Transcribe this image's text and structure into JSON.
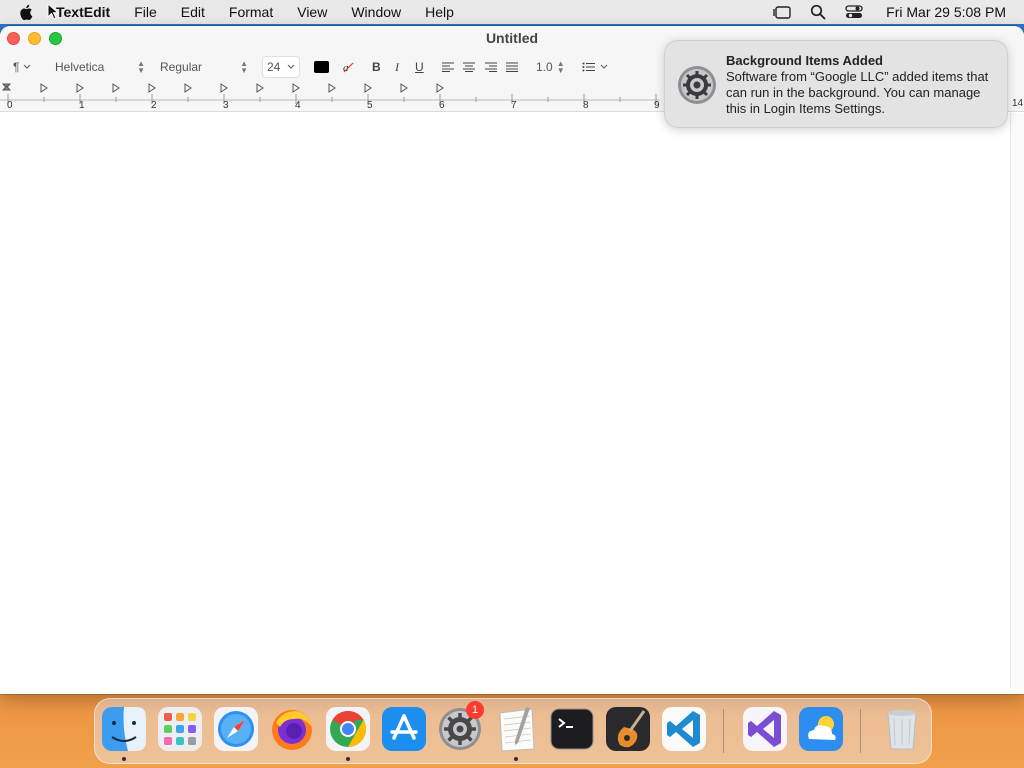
{
  "menubar": {
    "app_name": "TextEdit",
    "menus": [
      "File",
      "Edit",
      "Format",
      "View",
      "Window",
      "Help"
    ],
    "clock": "Fri Mar 29  5:08 PM"
  },
  "window": {
    "title": "Untitled",
    "toolbar": {
      "paragraph_style": "¶",
      "font_family": "Helvetica",
      "font_style": "Regular",
      "font_size": "24",
      "bold": "B",
      "italic": "I",
      "underline": "U",
      "line_spacing": "1.0",
      "text_color": "#000000"
    },
    "ruler_numbers": [
      "0",
      "1",
      "2",
      "3",
      "4",
      "5",
      "6",
      "7",
      "8",
      "9",
      "14"
    ]
  },
  "notification": {
    "title": "Background Items Added",
    "body": "Software from “Google LLC” added items that can run in the background. You can manage this in Login Items Settings.",
    "icon": "system-settings-gear-icon"
  },
  "dock": {
    "apps": [
      "Finder",
      "Launchpad",
      "Safari",
      "Firefox",
      "Chrome",
      "App Store",
      "System Settings",
      "TextEdit",
      "Terminal",
      "GarageBand",
      "Visual Studio Code",
      "Visual Studio",
      "Weather",
      "Trash"
    ],
    "system_settings_badge": "1"
  }
}
